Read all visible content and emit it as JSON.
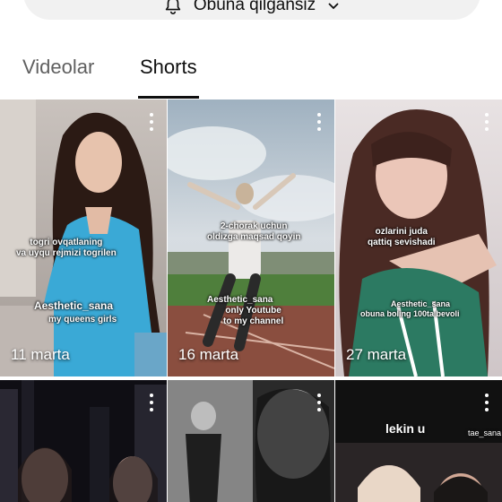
{
  "subscribe": {
    "label": "Obuna qilgansiz"
  },
  "tabs": [
    {
      "label": "Videolar",
      "active": false
    },
    {
      "label": "Shorts",
      "active": true
    }
  ],
  "shorts": [
    {
      "views": "11 marta",
      "caption_top": "togri ovqatlaning\nva uyqu rejmizi togrilen",
      "caption_bottom": "Aesthetic_sana",
      "caption_bottom2": "my queens girls"
    },
    {
      "views": "16 marta",
      "caption_top": "2-chorak uchun\noldizga maqsad qoyin",
      "caption_bottom": "Aesthetic_sana",
      "caption_bottom2": "only Youtube\nto my channel"
    },
    {
      "views": "27 marta",
      "caption_top": "ozlarini juda\nqattiq sevishadi",
      "caption_bottom": "Aesthetic_sana",
      "caption_bottom2": "obuna boling 100ta bevoli"
    },
    {
      "views": ""
    },
    {
      "views": ""
    },
    {
      "views": "",
      "caption_top": "lekin u",
      "watermark": "tae_sana"
    }
  ],
  "colors": {
    "active_tab": "#0f0f0f",
    "inactive_tab": "#606060",
    "subscribe_bg": "#f1f1f1"
  }
}
